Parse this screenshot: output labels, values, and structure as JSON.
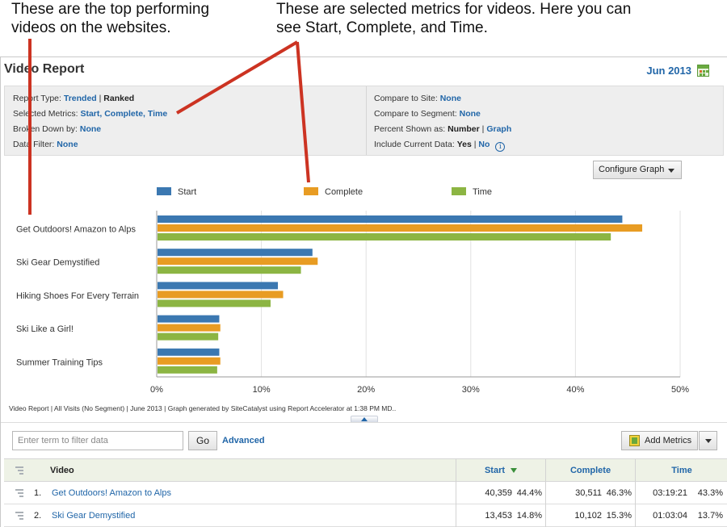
{
  "annotations": {
    "top_videos": "These are the top performing videos on the websites.",
    "metrics_note": "These are selected metrics for videos. Here you can see Start, Complete, and Time."
  },
  "report": {
    "title": "Video Report",
    "date": "Jun 2013",
    "calendar_icon": "calendar-icon"
  },
  "params": {
    "report_type_label": "Report Type:",
    "report_type_trended": "Trended",
    "report_type_sep": "|",
    "report_type_ranked": "Ranked",
    "selected_metrics_label": "Selected Metrics:",
    "selected_metrics_value": "Start, Complete, Time",
    "broken_down_label": "Broken Down by:",
    "broken_down_value": "None",
    "data_filter_label": "Data Filter:",
    "data_filter_value": "None",
    "compare_site_label": "Compare to Site:",
    "compare_site_value": "None",
    "compare_segment_label": "Compare to Segment:",
    "compare_segment_value": "None",
    "percent_label": "Percent Shown as:",
    "percent_number": "Number",
    "percent_sep": "|",
    "percent_graph": "Graph",
    "include_label": "Include Current Data:",
    "include_yes": "Yes",
    "include_sep": "|",
    "include_no": "No",
    "info_glyph": "i"
  },
  "configure_graph": "Configure Graph",
  "chart_data": {
    "type": "bar",
    "orientation": "horizontal",
    "categories": [
      "Get Outdoors! Amazon to Alps",
      "Ski Gear Demystified",
      "Hiking Shoes For Every Terrain",
      "Ski Like a Girl!",
      "Summer Training Tips"
    ],
    "series": [
      {
        "name": "Start",
        "color": "#3b78b1",
        "values": [
          44.4,
          14.8,
          11.5,
          5.9,
          5.9
        ]
      },
      {
        "name": "Complete",
        "color": "#e89c23",
        "values": [
          46.3,
          15.3,
          12.0,
          6.0,
          6.0
        ]
      },
      {
        "name": "Time",
        "color": "#8cb543",
        "values": [
          43.3,
          13.7,
          10.8,
          5.8,
          5.7
        ]
      }
    ],
    "x_ticks": [
      "0%",
      "10%",
      "20%",
      "30%",
      "40%",
      "50%"
    ],
    "xlim": [
      0,
      50
    ],
    "grid": true,
    "legend": "top"
  },
  "footnote": "Video Report | All Visits (No Segment) | June 2013 | Graph generated by SiteCatalyst using Report Accelerator at  1:38 PM MD..",
  "filter": {
    "placeholder": "Enter term to filter data",
    "go": "Go",
    "advanced": "Advanced"
  },
  "add_metrics": "Add Metrics",
  "table": {
    "headers": {
      "video": "Video",
      "start": "Start",
      "complete": "Complete",
      "time": "Time"
    },
    "rows": [
      {
        "num": "1.",
        "name": "Get Outdoors! Amazon to Alps",
        "start": "40,359",
        "start_pct": "44.4%",
        "complete": "30,511",
        "complete_pct": "46.3%",
        "time": "03:19:21",
        "time_pct": "43.3%"
      },
      {
        "num": "2.",
        "name": "Ski Gear Demystified",
        "start": "13,453",
        "start_pct": "14.8%",
        "complete": "10,102",
        "complete_pct": "15.3%",
        "time": "01:03:04",
        "time_pct": "13.7%"
      }
    ]
  }
}
